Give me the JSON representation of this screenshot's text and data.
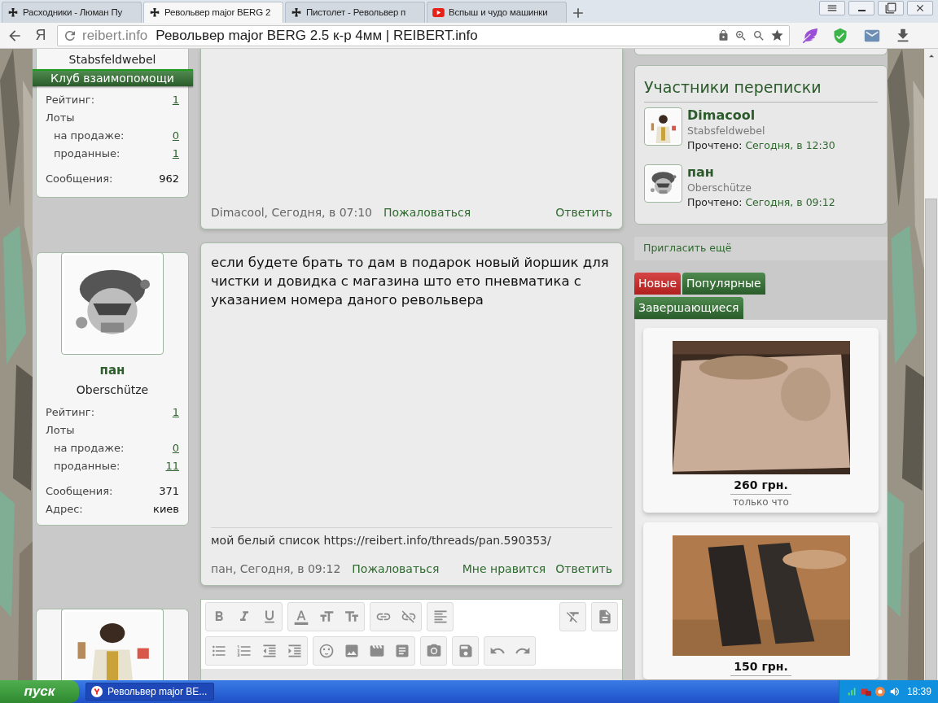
{
  "browser": {
    "tabs": [
      {
        "title": "Расходники - Люман Пу",
        "kind": "cross",
        "selected": false
      },
      {
        "title": "Револьвер major BERG 2",
        "kind": "cross",
        "selected": true
      },
      {
        "title": "Пистолет - Револьвер п",
        "kind": "cross",
        "selected": false
      },
      {
        "title": "Вспыш и чудо машинки",
        "kind": "video",
        "selected": false
      }
    ],
    "yandex_button": "Я",
    "address": {
      "domain": "reibert.info",
      "page_title": "Револьвер major BERG 2.5 к-р 4мм | REIBERT.info"
    }
  },
  "posts": [
    {
      "author": {
        "rank": "Stabsfeldwebel",
        "badge": "Клуб взаимопомощи",
        "stats": [
          {
            "label": "Рейтинг:",
            "value": "1",
            "kind": "link"
          },
          {
            "label": "Лоты",
            "kind": "group",
            "children": [
              {
                "label": "на продаже:",
                "value": "0",
                "kind": "link"
              },
              {
                "label": "проданные:",
                "value": "1",
                "kind": "link"
              }
            ]
          },
          {
            "label": "Сообщения:",
            "value": "962",
            "kind": "plain"
          }
        ]
      },
      "message": {
        "footer_meta": "Dimacool, Сегодня, в 07:10",
        "left_actions": [
          "Пожаловаться"
        ],
        "right_actions": [
          "Ответить"
        ]
      }
    },
    {
      "author": {
        "name": "пан",
        "rank": "Oberschütze",
        "stats": [
          {
            "label": "Рейтинг:",
            "value": "1",
            "kind": "link"
          },
          {
            "label": "Лоты",
            "kind": "group",
            "children": [
              {
                "label": "на продаже:",
                "value": "0",
                "kind": "link"
              },
              {
                "label": "проданные:",
                "value": "11",
                "kind": "link"
              }
            ]
          },
          {
            "label": "Сообщения:",
            "value": "371",
            "kind": "plain"
          },
          {
            "label": "Адрес:",
            "value": "киев",
            "kind": "plain"
          }
        ]
      },
      "message": {
        "text": "если будете брать то дам в подарок новый йоршик для чистки и довидка с магазина што ето пневматика с указанием номера даного револьвера",
        "signature": "мой белый список https://reibert.info/threads/pan.590353/",
        "footer_meta": "пан, Сегодня, в 09:12",
        "left_actions": [
          "Пожаловаться"
        ],
        "right_actions": [
          "Мне нравится",
          "Ответить"
        ]
      }
    }
  ],
  "sidebar": {
    "participants": {
      "title": "Участники переписки",
      "members": [
        {
          "name": "Dimacool",
          "rank": "Stabsfeldwebel",
          "read_label": "Прочтено:",
          "read_time": "Сегодня, в 12:30"
        },
        {
          "name": "пан",
          "rank": "Oberschütze",
          "read_label": "Прочтено:",
          "read_time": "Сегодня, в 09:12"
        }
      ]
    },
    "invite": "Пригласить ещё",
    "listing_tabs": [
      {
        "label": "Новые",
        "selected": true
      },
      {
        "label": "Популярные",
        "selected": false
      },
      {
        "label": "Завершающиеся",
        "selected": false
      }
    ],
    "listings": [
      {
        "price": "260 грн.",
        "time": "только что"
      },
      {
        "price": "150 грн."
      }
    ]
  },
  "taskbar": {
    "start": "пуск",
    "tasks": [
      "Револьвер major BE..."
    ],
    "clock": "18:39"
  }
}
